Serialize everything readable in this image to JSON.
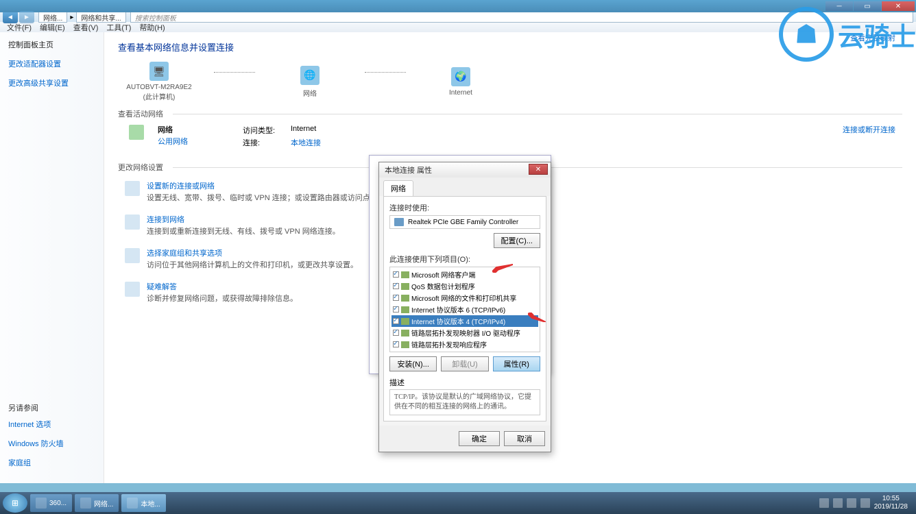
{
  "window": {
    "bc1": "网络...",
    "bc2": "网络和共享...",
    "search_placeholder": "搜索控制面板"
  },
  "menus": [
    "文件(F)",
    "编辑(E)",
    "查看(V)",
    "工具(T)",
    "帮助(H)"
  ],
  "sidebar": {
    "title": "控制面板主页",
    "links": [
      "更改适配器设置",
      "更改高级共享设置"
    ],
    "see_also": "另请参阅",
    "see_also_links": [
      "Internet 选项",
      "Windows 防火墙",
      "家庭组"
    ]
  },
  "content": {
    "heading": "查看基本网络信息并设置连接",
    "map_link": "查看完整映射",
    "nodes": {
      "pc": "AUTOBVT-M2RA9E2",
      "pc_sub": "(此计算机)",
      "net": "网络",
      "internet": "Internet"
    },
    "active_label": "查看活动网络",
    "conn_link": "连接或断开连接",
    "active": {
      "name": "网络",
      "type": "公用网络",
      "access_label": "访问类型:",
      "access_value": "Internet",
      "conn_label": "连接:",
      "conn_value": "本地连接"
    },
    "change_label": "更改网络设置",
    "settings": [
      {
        "title": "设置新的连接或网络",
        "desc": "设置无线、宽带、拨号、临时或 VPN 连接；或设置路由器或访问点。"
      },
      {
        "title": "连接到网络",
        "desc": "连接到或重新连接到无线、有线、拨号或 VPN 网络连接。"
      },
      {
        "title": "选择家庭组和共享选项",
        "desc": "访问位于其他网络计算机上的文件和打印机，或更改共享设置。"
      },
      {
        "title": "疑难解答",
        "desc": "诊断并修复网络问题，或获得故障排除信息。"
      }
    ]
  },
  "dialog": {
    "title": "本地连接 属性",
    "tab": "网络",
    "connect_using": "连接时使用:",
    "adapter": "Realtek PCIe GBE Family Controller",
    "config_btn": "配置(C)...",
    "items_label": "此连接使用下列项目(O):",
    "items": [
      "Microsoft 网络客户端",
      "QoS 数据包计划程序",
      "Microsoft 网络的文件和打印机共享",
      "Internet 协议版本 6 (TCP/IPv6)",
      "Internet 协议版本 4 (TCP/IPv4)",
      "链路层拓扑发现映射器 I/O 驱动程序",
      "链路层拓扑发现响应程序"
    ],
    "install": "安装(N)...",
    "uninstall": "卸载(U)",
    "properties": "属性(R)",
    "desc_label": "描述",
    "desc_text": "TCP/IP。该协议是默认的广域网络协议，它提供在不同的相互连接的网络上的通讯。",
    "ok": "确定",
    "cancel": "取消"
  },
  "taskbar": {
    "items": [
      "360...",
      "网络...",
      "本地..."
    ],
    "time": "10:55",
    "date": "2019/11/28"
  },
  "watermark": "云骑士"
}
